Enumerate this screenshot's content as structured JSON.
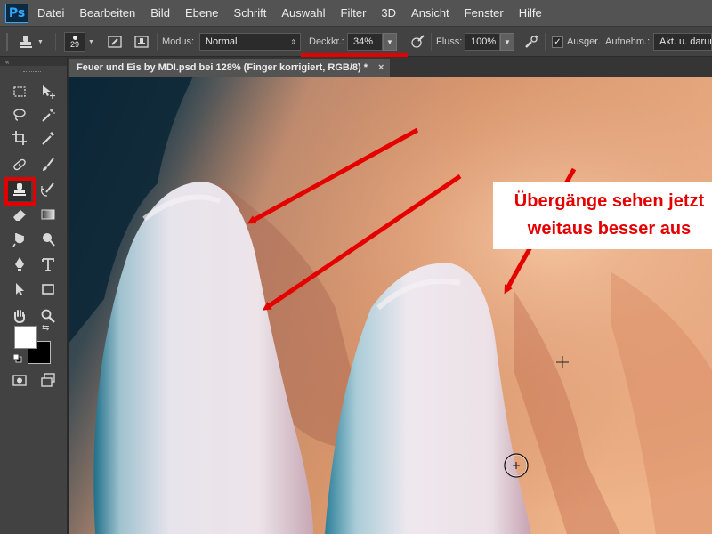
{
  "app": {
    "logo_text": "Ps"
  },
  "menu": [
    "Datei",
    "Bearbeiten",
    "Bild",
    "Ebene",
    "Schrift",
    "Auswahl",
    "Filter",
    "3D",
    "Ansicht",
    "Fenster",
    "Hilfe"
  ],
  "options": {
    "brush_size": "29",
    "mode_label": "Modus:",
    "mode_value": "Normal",
    "opacity_label": "Deckkr.:",
    "opacity_value": "34%",
    "flow_label": "Fluss:",
    "flow_value": "100%",
    "aligned_label": "Ausger.",
    "sample_label": "Aufnehm.:",
    "sample_value": "Akt. u. darun"
  },
  "document": {
    "tab_title": "Feuer und Eis by MDI.psd bei 128% (Finger korrigiert, RGB/8) *",
    "close_symbol": "×"
  },
  "annotation": {
    "line1": "Übergänge sehen jetzt",
    "line2": "weitaus besser aus"
  },
  "colors": {
    "highlight_red": "#e50000",
    "foreground": "#ffffff",
    "background": "#000000"
  },
  "tools": [
    "marquee-icon",
    "move-icon",
    "lasso-icon",
    "magic-wand-icon",
    "crop-icon",
    "eyedropper-icon",
    "healing-brush-icon",
    "brush-icon",
    "clone-stamp-icon",
    "history-brush-icon",
    "eraser-icon",
    "gradient-icon",
    "blur-icon",
    "dodge-icon",
    "pen-icon",
    "type-icon",
    "path-selection-icon",
    "shape-icon",
    "hand-icon",
    "zoom-icon"
  ]
}
